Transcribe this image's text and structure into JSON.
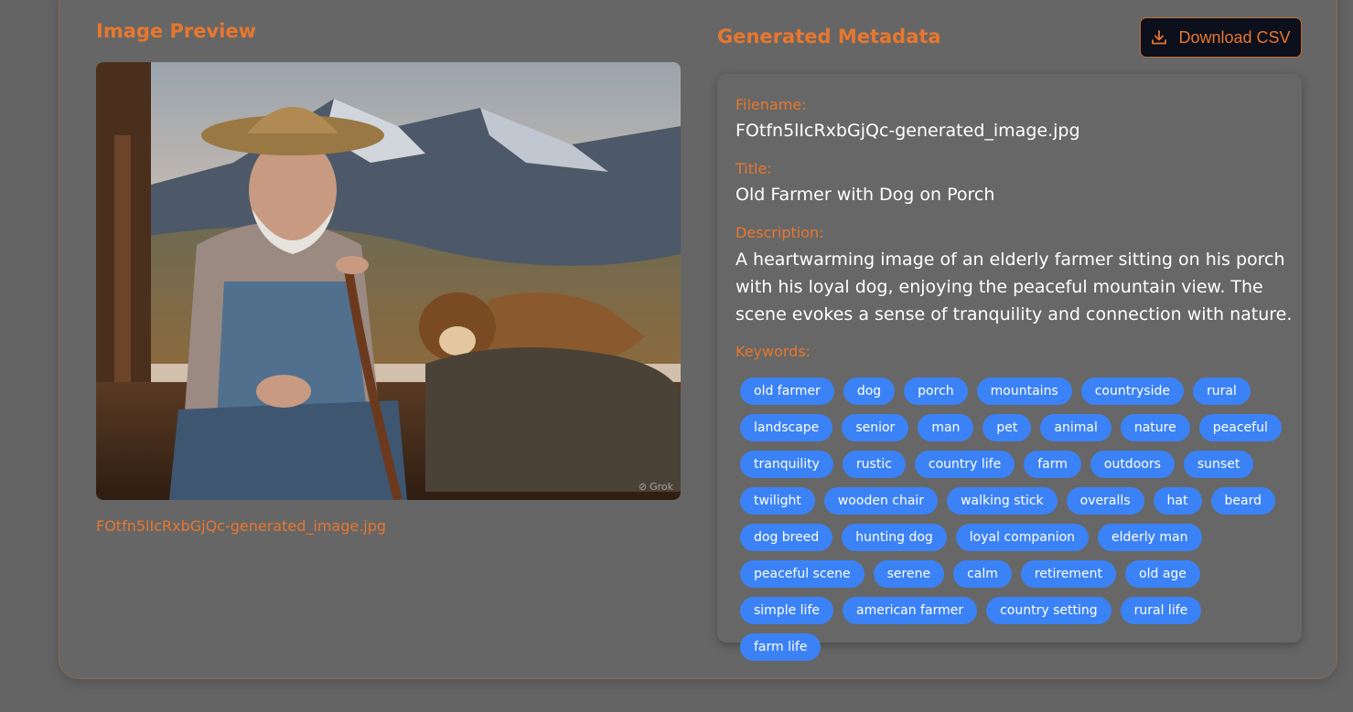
{
  "preview": {
    "title": "Image Preview",
    "filename": "FOtfn5lIcRxbGjQc-generated_image.jpg",
    "watermark": "Grok"
  },
  "metadata": {
    "title": "Generated Metadata",
    "download_label": "Download CSV",
    "filename_label": "Filename:",
    "filename_value": "FOtfn5lIcRxbGjQc-generated_image.jpg",
    "title_label": "Title:",
    "title_value": "Old Farmer with Dog on Porch",
    "description_label": "Description:",
    "description_value": "A heartwarming image of an elderly farmer sitting on his porch with his loyal dog, enjoying the peaceful mountain view. The scene evokes a sense of tranquility and connection with nature.",
    "keywords_label": "Keywords:",
    "keywords": [
      "old farmer",
      "dog",
      "porch",
      "mountains",
      "countryside",
      "rural",
      "landscape",
      "senior",
      "man",
      "pet",
      "animal",
      "nature",
      "peaceful",
      "tranquility",
      "rustic",
      "country life",
      "farm",
      "outdoors",
      "sunset",
      "twilight",
      "wooden chair",
      "walking stick",
      "overalls",
      "hat",
      "beard",
      "dog breed",
      "hunting dog",
      "loyal companion",
      "elderly man",
      "peaceful scene",
      "serene",
      "calm",
      "retirement",
      "old age",
      "simple life",
      "american farmer",
      "country setting",
      "rural life",
      "farm life"
    ]
  },
  "colors": {
    "accent": "#e8772e",
    "tag_bg": "#3b82f6",
    "background": "#646464",
    "button_bg": "#0c0f1c"
  },
  "icons": {
    "download": "download-icon",
    "watermark": "grok-logo-icon"
  }
}
